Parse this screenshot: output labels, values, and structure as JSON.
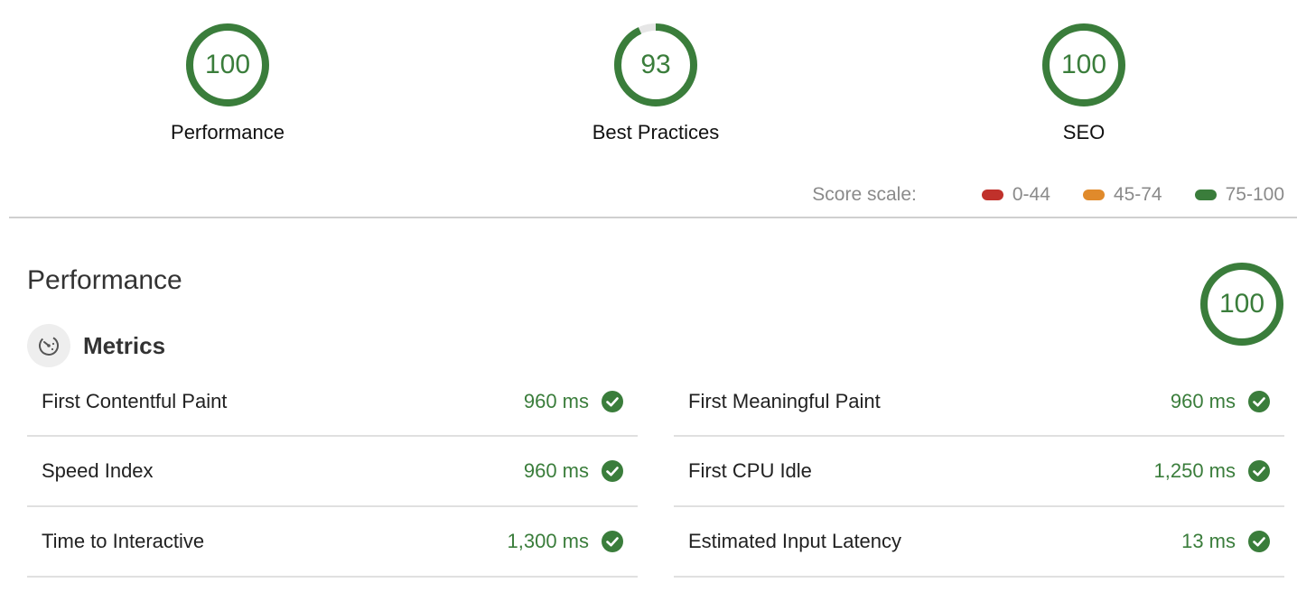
{
  "colors": {
    "pass": "#3a7d3b",
    "average": "#e08a2b",
    "fail": "#c0312b",
    "ring_track": "#e6e6e6"
  },
  "gauges": [
    {
      "label": "Performance",
      "score": 100
    },
    {
      "label": "Best Practices",
      "score": 93
    },
    {
      "label": "SEO",
      "score": 100
    }
  ],
  "score_scale": {
    "title": "Score scale:",
    "ranges": [
      {
        "label": "0-44",
        "color": "#c0312b"
      },
      {
        "label": "45-74",
        "color": "#e08a2b"
      },
      {
        "label": "75-100",
        "color": "#3a7d3b"
      }
    ]
  },
  "performance": {
    "title": "Performance",
    "score": 100,
    "metrics_title": "Metrics",
    "metrics_icon": "gauge-icon",
    "left": [
      {
        "name": "First Contentful Paint",
        "value": "960 ms",
        "icon": "check-circle-icon"
      },
      {
        "name": "Speed Index",
        "value": "960 ms",
        "icon": "check-circle-icon"
      },
      {
        "name": "Time to Interactive",
        "value": "1,300 ms",
        "icon": "check-circle-icon"
      }
    ],
    "right": [
      {
        "name": "First Meaningful Paint",
        "value": "960 ms",
        "icon": "check-circle-icon"
      },
      {
        "name": "First CPU Idle",
        "value": "1,250 ms",
        "icon": "check-circle-icon"
      },
      {
        "name": "Estimated Input Latency",
        "value": "13 ms",
        "icon": "check-circle-icon"
      }
    ]
  }
}
